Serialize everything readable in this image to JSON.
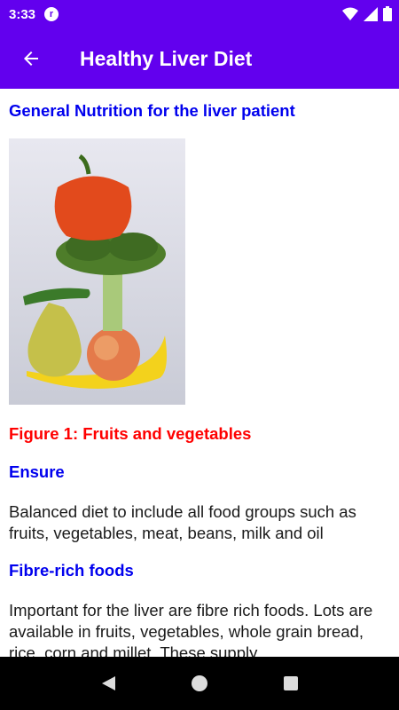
{
  "status_bar": {
    "time": "3:33",
    "notification_icon_letter": "r"
  },
  "app_bar": {
    "title": "Healthy Liver Diet"
  },
  "content": {
    "section_title": "General Nutrition for the liver patient",
    "figure_caption": "Figure 1: Fruits and vegetables",
    "ensure_heading": "Ensure",
    "ensure_text": "Balanced diet to include all food groups such as fruits, vegetables, meat, beans, milk and oil",
    "fibre_heading": "Fibre-rich foods",
    "fibre_text": "Important for the liver are fibre rich foods. Lots are available in fruits, vegetables, whole grain bread, rice, corn and millet. These supply"
  },
  "colors": {
    "primary": "#6200ee",
    "heading_blue": "#0000ee",
    "caption_red": "#ff0000"
  }
}
